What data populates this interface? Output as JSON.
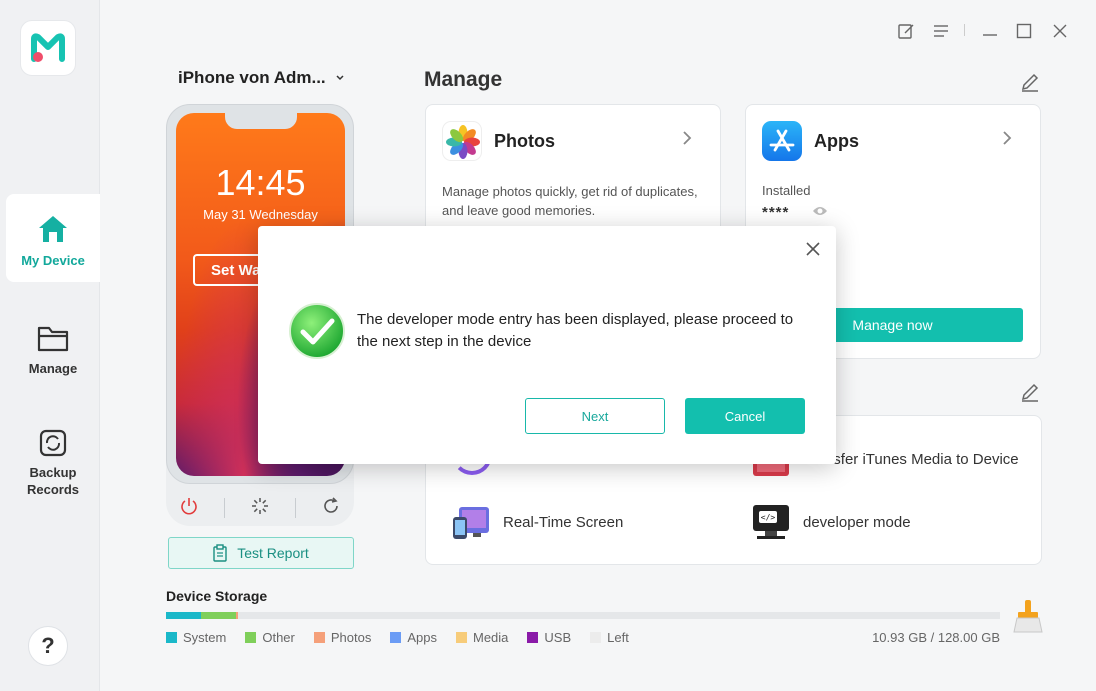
{
  "sidebar": {
    "items": [
      {
        "label": "My Device"
      },
      {
        "label": "Manage"
      },
      {
        "label": "Backup\nRecords"
      }
    ],
    "help_label": "?"
  },
  "device": {
    "name": "iPhone von Adm...",
    "lock_time": "14:45",
    "lock_date": "May 31 Wednesday",
    "set_wallpaper": "Set Wallpaper",
    "test_report": "Test Report"
  },
  "manage": {
    "title": "Manage",
    "photos": {
      "title": "Photos",
      "desc": "Manage photos quickly, get rid of duplicates, and leave good memories."
    },
    "apps": {
      "title": "Apps",
      "installed_label": "Installed",
      "installed_value": "****",
      "manage_now": "Manage now"
    },
    "tools": [
      {
        "label": "Transfer iTunes Media to Device"
      },
      {
        "label": "Real-Time Screen"
      },
      {
        "label": "developer mode"
      }
    ]
  },
  "storage": {
    "title": "Device Storage",
    "legend": [
      {
        "label": "System",
        "color": "#1ab8c9"
      },
      {
        "label": "Other",
        "color": "#7fcf5a"
      },
      {
        "label": "Photos",
        "color": "#f5a07a"
      },
      {
        "label": "Apps",
        "color": "#6b9cf5"
      },
      {
        "label": "Media",
        "color": "#f7cc7a"
      },
      {
        "label": "USB",
        "color": "#8a1aa8"
      },
      {
        "label": "Left",
        "color": "#ececec"
      }
    ],
    "used": "10.93 GB / 128.00 GB"
  },
  "dialog": {
    "message": "The developer mode entry has been displayed, please proceed to the next step in the device",
    "next": "Next",
    "cancel": "Cancel"
  }
}
